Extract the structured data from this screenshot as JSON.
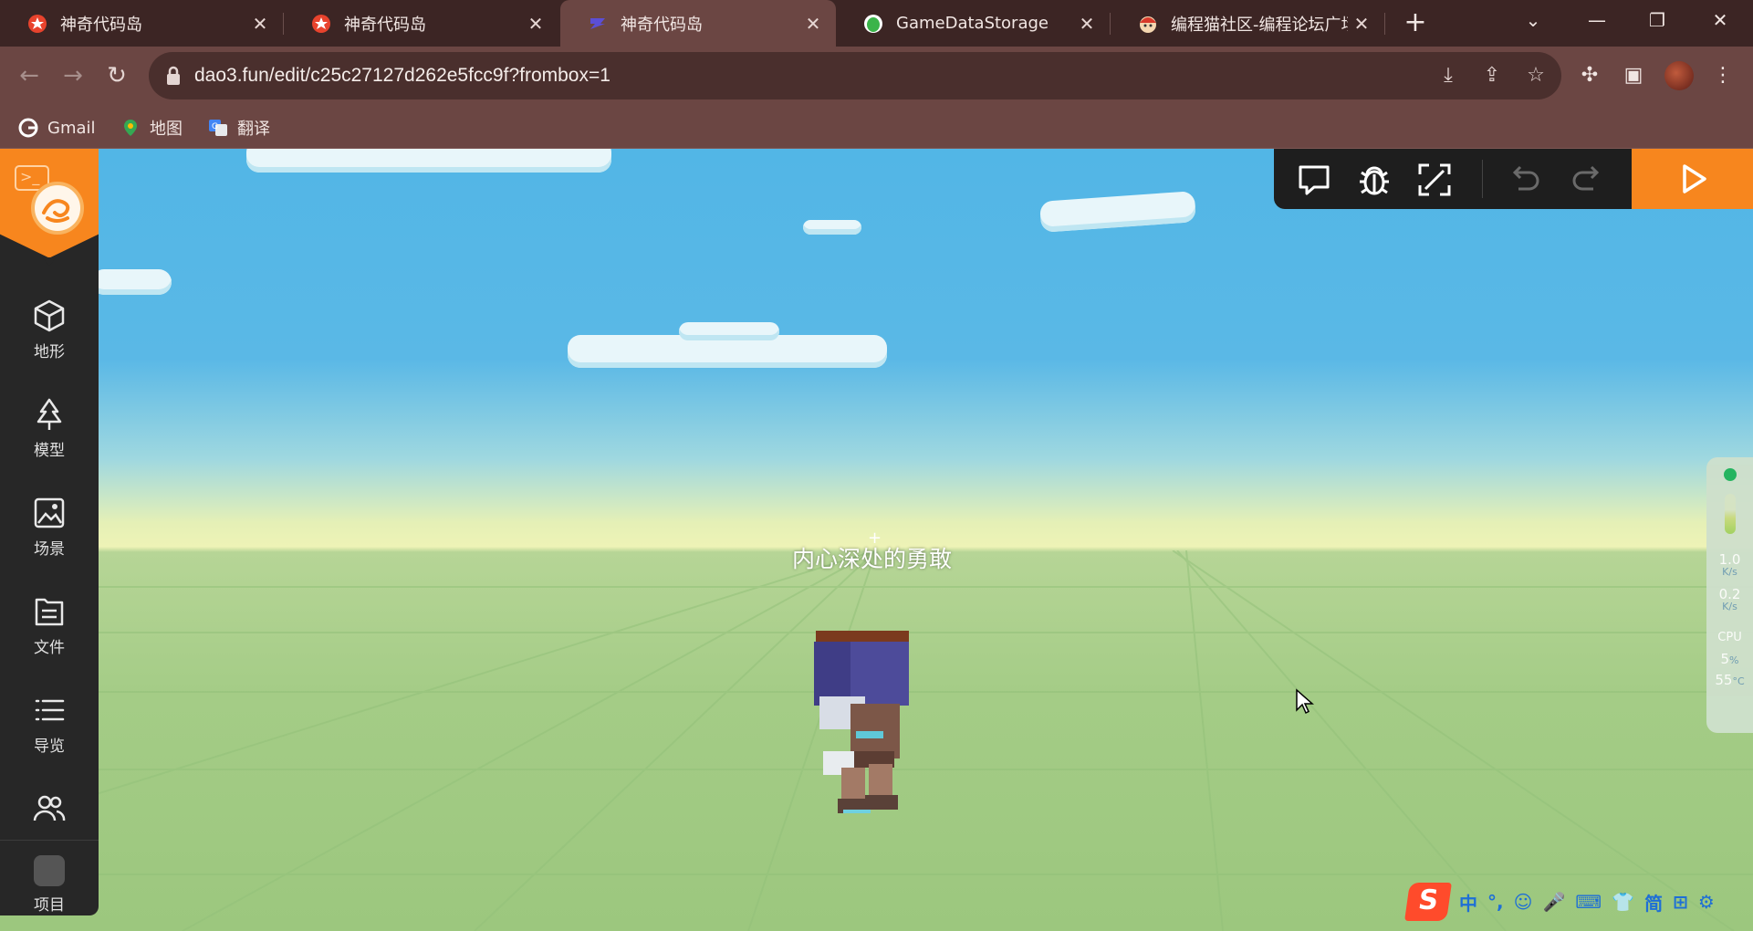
{
  "browser": {
    "tabs": [
      {
        "title": "神奇代码岛",
        "active": false,
        "icon": "dao3-icon"
      },
      {
        "title": "神奇代码岛",
        "active": false,
        "icon": "dao3-icon"
      },
      {
        "title": "神奇代码岛",
        "active": true,
        "icon": "dao3-editor-icon"
      },
      {
        "title": "GameDataStorage",
        "active": false,
        "icon": "green-blob-icon"
      },
      {
        "title": "编程猫社区-编程论坛广场",
        "active": false,
        "icon": "codemao-icon"
      }
    ],
    "tab_close": "✕",
    "new_tab": "+",
    "address": "dao3.fun/edit/c25c27127d262e5fcc9f?frombox=1",
    "bookmarks": [
      {
        "label": "Gmail",
        "icon": "google-icon"
      },
      {
        "label": "地图",
        "icon": "maps-pin-icon"
      },
      {
        "label": "翻译",
        "icon": "translate-icon"
      }
    ]
  },
  "sidebar": {
    "items": [
      {
        "label": "地形",
        "icon": "cube-icon"
      },
      {
        "label": "模型",
        "icon": "tree-icon"
      },
      {
        "label": "场景",
        "icon": "image-icon"
      },
      {
        "label": "文件",
        "icon": "document-icon"
      },
      {
        "label": "导览",
        "icon": "list-icon"
      },
      {
        "label": "",
        "icon": "users-icon"
      }
    ],
    "bottom_label": "项目"
  },
  "scene": {
    "player_name": "内心深处的勇敢",
    "crosshair": "+"
  },
  "stats": {
    "upload": "1.0",
    "upload_unit": "K/s",
    "download": "0.2",
    "download_unit": "K/s",
    "cpu_label": "CPU",
    "cpu_value": "5",
    "cpu_unit": "%",
    "temp_value": "55",
    "temp_unit": "°C"
  },
  "ime": {
    "logo": "S",
    "items": [
      "中",
      "°,",
      "☺",
      "🎤",
      "⌨",
      "👕",
      "简",
      "⊞",
      "⚙"
    ]
  },
  "colors": {
    "brand_orange": "#f7861e",
    "chrome_dark": "#3c2524",
    "chrome_mid": "#6b4643",
    "sidebar_bg": "#272727",
    "status_green": "#1eb25a"
  }
}
